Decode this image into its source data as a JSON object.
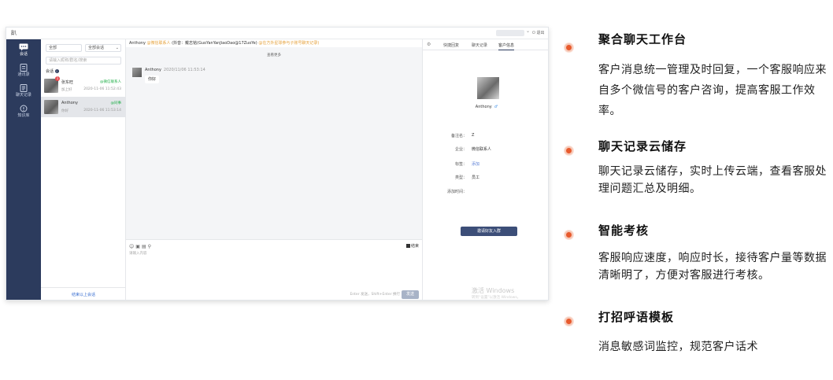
{
  "app": {
    "logo_text": "趴",
    "logout_label": "退出",
    "nav": [
      {
        "label": "会话",
        "icon": "chat-icon",
        "active": true
      },
      {
        "label": "通讯录",
        "icon": "contacts-icon",
        "active": false
      },
      {
        "label": "聊天记录",
        "icon": "record-icon",
        "active": false
      },
      {
        "label": "知识库",
        "icon": "knowledge-icon",
        "active": false
      }
    ],
    "list": {
      "filter_all": "全部",
      "filter_sessions": "全部会话",
      "search_placeholder": "请输入昵称/群名/搜索",
      "section_title": "会话",
      "conversations": [
        {
          "name": "张东旺",
          "tag": "@微信联系人",
          "sub": "加上好",
          "time": "2020-11-06 11:52:43",
          "badge": "1"
        },
        {
          "name": "Anthony",
          "tag": "@同事",
          "sub": "你好",
          "time": "2020-11-06 11:53:14",
          "badge": ""
        }
      ],
      "footer": "结束以上会话"
    },
    "chat": {
      "header_name": "Anthony",
      "header_tag1": "@微信联系人",
      "header_middle": "(抖音：戴志铭(GuoYanYanJiaoDao@17ZuoYe)",
      "header_tag2": "@在方外星球参与子账号聊天记录)",
      "load_more": "查看更多",
      "message": {
        "sender": "Anthony",
        "time": "2020/11/06 11:53:14",
        "text": "你好"
      },
      "composer_tools": "☺ ▣ ▤ ⚲",
      "end_label": "结束",
      "input_placeholder": "请输入内容",
      "send_hint": "Enter 发送，Shift+Enter 换行",
      "send_label": "发送"
    },
    "info": {
      "tabs": [
        "快捷回复",
        "聊天记录",
        "客户信息"
      ],
      "active_tab": 2,
      "profile_name": "Anthony",
      "sex_symbol": "♂",
      "fields": [
        {
          "label": "备注名：",
          "value": "Z",
          "link": false
        },
        {
          "label": "企业：",
          "value": "微信联系人",
          "link": false
        },
        {
          "label": "标签：",
          "value": "添加",
          "link": true
        },
        {
          "label": "类型：",
          "value": "员工",
          "link": false
        },
        {
          "label": "添加时间：",
          "value": "",
          "link": false
        }
      ],
      "add_button": "邀请好友入群",
      "watermark_title": "激活 Windows",
      "watermark_sub": "转到“设置”以激活 Windows。"
    }
  },
  "features": [
    {
      "title": "聚合聊天工作台",
      "desc": "客户消息统一管理及时回复，一个客服响应来自多个微信号的客户咨询，提高客服工作效率。"
    },
    {
      "title": "聊天记录云储存",
      "desc": "聊天记录云储存，实时上传云端，查看客服处理问题汇总及明细。"
    },
    {
      "title": "智能考核",
      "desc": "客服响应速度，响应时长，接待客户量等数据清晰明了，方便对客服进行考核。"
    },
    {
      "title": "打招呼语模板",
      "desc": "消息敏感词监控，规范客户话术"
    }
  ],
  "colors": {
    "nav_bg": "#2c3b5d",
    "bullet": "#e85a2d",
    "accent_green": "#1fae47",
    "accent_orange": "#e6a23c"
  }
}
